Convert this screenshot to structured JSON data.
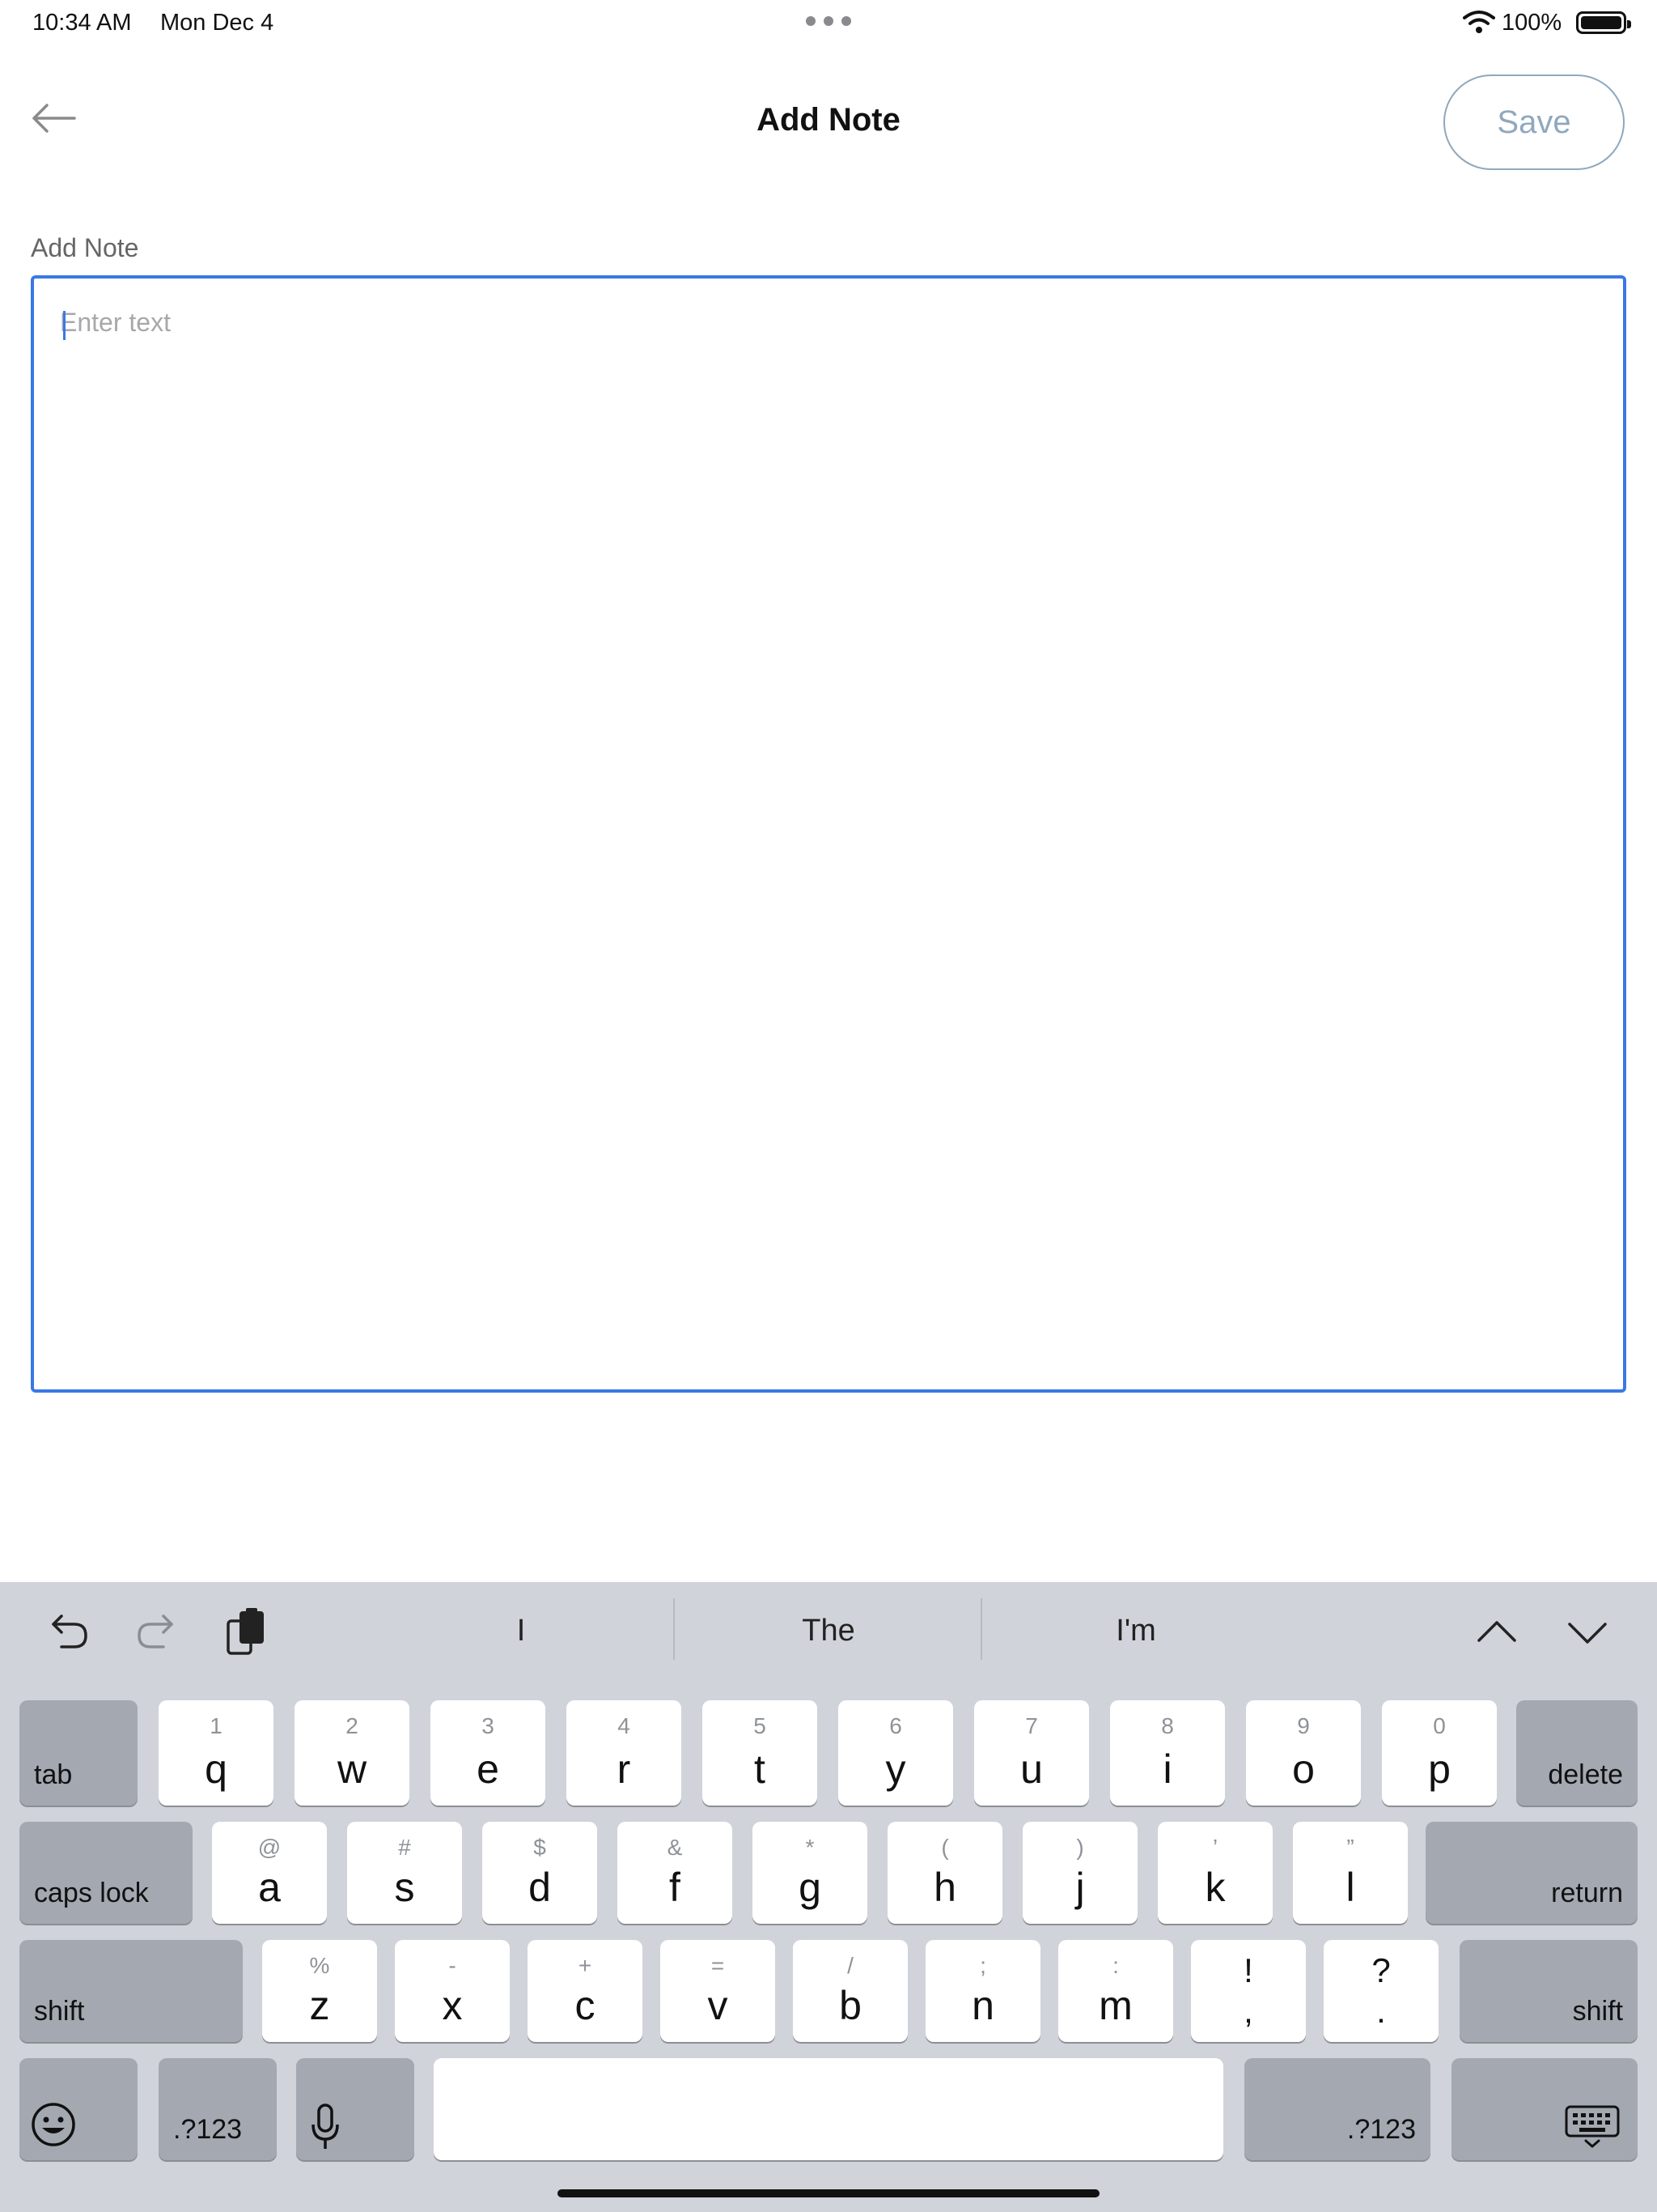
{
  "status_bar": {
    "time": "10:34 AM",
    "date": "Mon Dec 4",
    "battery": "100%"
  },
  "header": {
    "title": "Add Note",
    "save_label": "Save",
    "back_icon": "arrow-left-icon"
  },
  "note": {
    "label": "Add Note",
    "placeholder": "Enter text",
    "value": ""
  },
  "colors": {
    "accent": "#3a78e6",
    "save_outline": "#8fa8bd",
    "keyboard_bg": "#d0d3d9",
    "key_dark": "#a3a8b1"
  },
  "keyboard": {
    "suggestions": [
      "I",
      "The",
      "I'm"
    ],
    "row1": [
      {
        "sec": "1",
        "pri": "q"
      },
      {
        "sec": "2",
        "pri": "w"
      },
      {
        "sec": "3",
        "pri": "e"
      },
      {
        "sec": "4",
        "pri": "r"
      },
      {
        "sec": "5",
        "pri": "t"
      },
      {
        "sec": "6",
        "pri": "y"
      },
      {
        "sec": "7",
        "pri": "u"
      },
      {
        "sec": "8",
        "pri": "i"
      },
      {
        "sec": "9",
        "pri": "o"
      },
      {
        "sec": "0",
        "pri": "p"
      }
    ],
    "row2": [
      {
        "sec": "@",
        "pri": "a"
      },
      {
        "sec": "#",
        "pri": "s"
      },
      {
        "sec": "$",
        "pri": "d"
      },
      {
        "sec": "&",
        "pri": "f"
      },
      {
        "sec": "*",
        "pri": "g"
      },
      {
        "sec": "(",
        "pri": "h"
      },
      {
        "sec": ")",
        "pri": "j"
      },
      {
        "sec": "’",
        "pri": "k"
      },
      {
        "sec": "”",
        "pri": "l"
      }
    ],
    "row3": [
      {
        "sec": "%",
        "pri": "z"
      },
      {
        "sec": "-",
        "pri": "x"
      },
      {
        "sec": "+",
        "pri": "c"
      },
      {
        "sec": "=",
        "pri": "v"
      },
      {
        "sec": "/",
        "pri": "b"
      },
      {
        "sec": ";",
        "pri": "n"
      },
      {
        "sec": ":",
        "pri": "m"
      },
      {
        "sec": "!",
        "pri": ","
      },
      {
        "sec": "?",
        "pri": "."
      }
    ],
    "tab": "tab",
    "delete": "delete",
    "caps_lock": "caps lock",
    "return": "return",
    "shift": "shift",
    "numbers": ".?123",
    "icons": {
      "undo": "undo-icon",
      "redo": "redo-icon",
      "paste": "clipboard-icon",
      "prev": "chevron-up-icon",
      "next": "chevron-down-icon",
      "emoji": "emoji-icon",
      "mic": "microphone-icon",
      "hide": "keyboard-dismiss-icon"
    }
  }
}
